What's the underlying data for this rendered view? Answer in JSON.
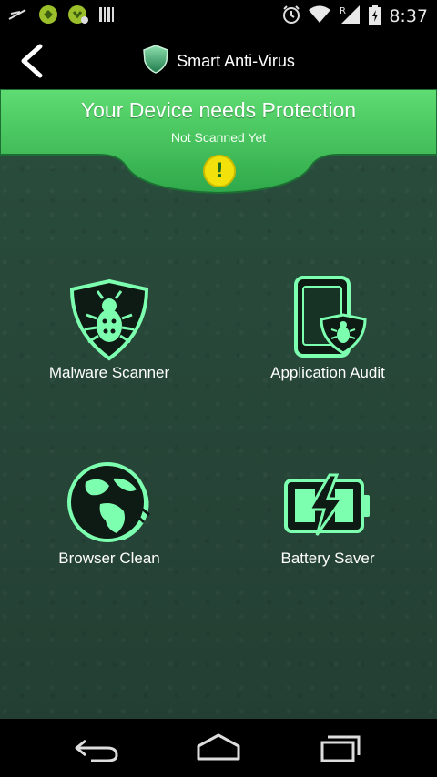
{
  "status_bar": {
    "time": "8:37",
    "left_icons": [
      "usb-debug-icon",
      "app-notification-icon",
      "app-notification-icon-2",
      "barcode-icon"
    ],
    "right_icons": [
      "alarm-icon",
      "wifi-icon",
      "roaming-signal-icon",
      "battery-icon"
    ],
    "roaming_indicator": "R"
  },
  "app_bar": {
    "title": "Smart Anti-Virus",
    "back_icon": "chevron-left-icon",
    "logo_icon": "shield-icon"
  },
  "banner": {
    "title": "Your Device needs Protection",
    "subtitle": "Not Scanned Yet",
    "warning_glyph": "!",
    "banner_color": "#3fbf55",
    "warning_color": "#f2e10a"
  },
  "features": [
    {
      "label": "Malware Scanner",
      "icon": "bug-shield-icon"
    },
    {
      "label": "Application Audit",
      "icon": "phone-bug-icon"
    },
    {
      "label": "Browser Clean",
      "icon": "globe-clean-icon"
    },
    {
      "label": "Battery Saver",
      "icon": "battery-bolt-icon"
    }
  ],
  "nav_bar": {
    "buttons": [
      "back-nav-icon",
      "home-nav-icon",
      "recents-nav-icon"
    ]
  },
  "colors": {
    "accent_green": "#7dffb0",
    "background": "#26493a"
  }
}
